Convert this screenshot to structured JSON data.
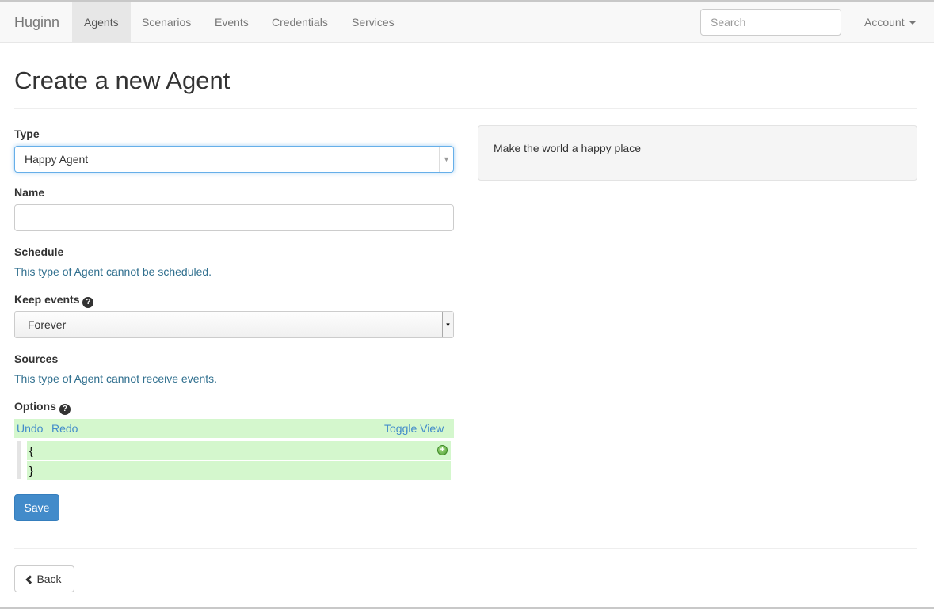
{
  "nav": {
    "brand": "Huginn",
    "items": [
      {
        "label": "Agents",
        "active": true
      },
      {
        "label": "Scenarios",
        "active": false
      },
      {
        "label": "Events",
        "active": false
      },
      {
        "label": "Credentials",
        "active": false
      },
      {
        "label": "Services",
        "active": false
      }
    ],
    "search_placeholder": "Search",
    "account_label": "Account"
  },
  "page": {
    "title": "Create a new Agent"
  },
  "form": {
    "type_label": "Type",
    "type_value": "Happy Agent",
    "name_label": "Name",
    "name_value": "",
    "schedule_label": "Schedule",
    "schedule_info": "This type of Agent cannot be scheduled.",
    "keep_events_label": "Keep events",
    "keep_events_value": "Forever",
    "sources_label": "Sources",
    "sources_info": "This type of Agent cannot receive events.",
    "options_label": "Options",
    "save_label": "Save"
  },
  "editor": {
    "undo": "Undo",
    "redo": "Redo",
    "toggle_view": "Toggle View",
    "lines": [
      "{",
      "}"
    ]
  },
  "description": "Make the world a happy place",
  "footer": {
    "back_label": "Back"
  },
  "colors": {
    "primary": "#428bca",
    "info_text": "#31708f",
    "editor_highlight": "#d4f7cd"
  }
}
